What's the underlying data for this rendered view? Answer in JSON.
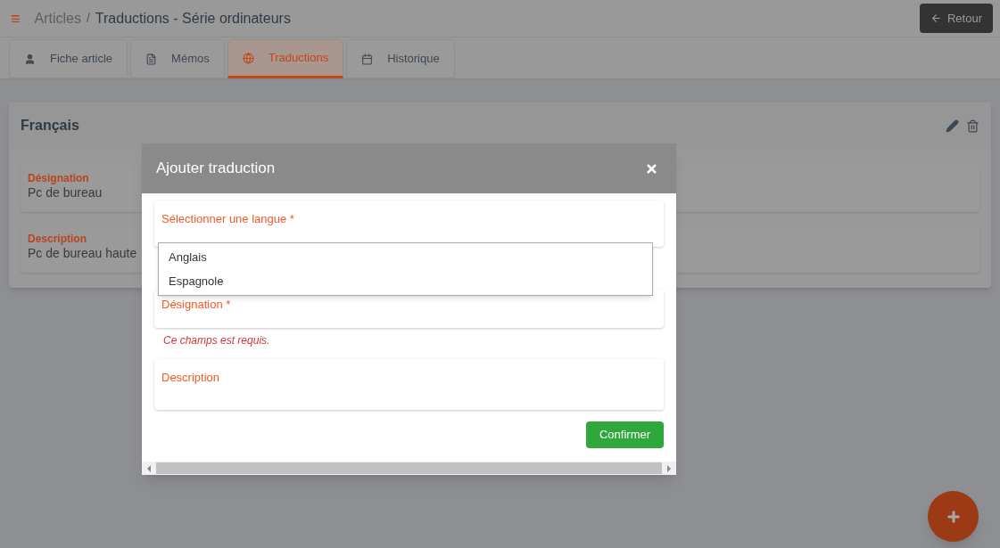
{
  "header": {
    "menu_icon": "≡",
    "breadcrumb_parent": "Articles",
    "separator": "/",
    "title": "Traductions - Série ordinateurs",
    "back_button": "Retour"
  },
  "tabs": [
    {
      "label": "Fiche article",
      "selected": false
    },
    {
      "label": "Mémos",
      "selected": false
    },
    {
      "label": "Traductions",
      "selected": true
    },
    {
      "label": "Historique",
      "selected": false
    }
  ],
  "card": {
    "title": "Français",
    "fields": [
      {
        "label": "Désignation",
        "value": "Pc de bureau"
      },
      {
        "label": "Description",
        "value": "Pc de bureau haute"
      }
    ]
  },
  "modal": {
    "title": "Ajouter traduction",
    "language_field": {
      "label": "Sélectionner une langue *",
      "options": [
        "Anglais",
        "Espagnole"
      ]
    },
    "designation_field": {
      "label": "Désignation *",
      "error": "Ce champs est requis."
    },
    "description_field": {
      "label": "Description"
    },
    "confirm_button": "Confirmer"
  }
}
